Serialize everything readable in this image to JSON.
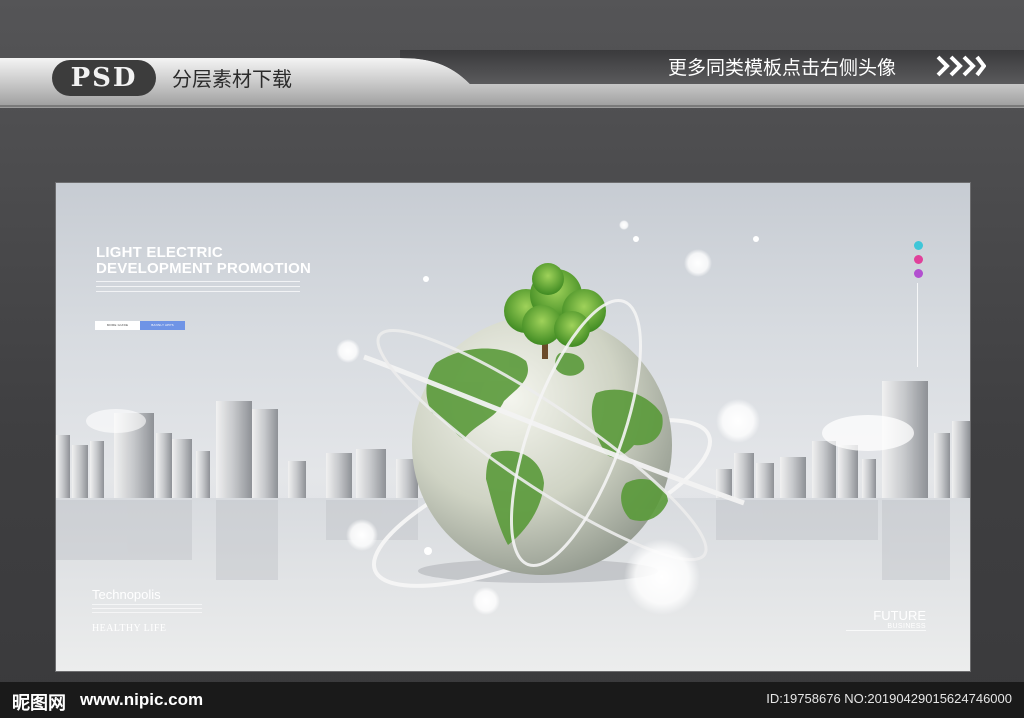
{
  "banner": {
    "badge": "PSD",
    "left_text": "分层素材下载",
    "right_text": "更多同类模板点击右侧头像"
  },
  "poster": {
    "headline_line1": "LIGHT ELECTRIC",
    "headline_line2": "DEVELOPMENT PROMOTION",
    "button_left": "MORE GUIDE",
    "button_right": "BANNLY APPS",
    "technopolis": "Technopolis",
    "healthy_life": "HEALTHY LIFE",
    "future": "FUTURE",
    "business": "BUSINESS"
  },
  "footer": {
    "logo": "昵图网",
    "url": "www.nipic.com",
    "id_text": "ID:19758676 NO:20190429015624746000"
  },
  "colors": {
    "background": "#4b4b4d",
    "accent_blue": "#6f94e6",
    "globe_green": "#5a9a3a",
    "side_dot_cyan": "#3fc6d8",
    "side_dot_pink": "#e0409a",
    "side_dot_purple": "#b24fd0"
  },
  "icons": [
    "chevrons-right-icon",
    "share-icon",
    "settings-icon",
    "user-icon"
  ]
}
